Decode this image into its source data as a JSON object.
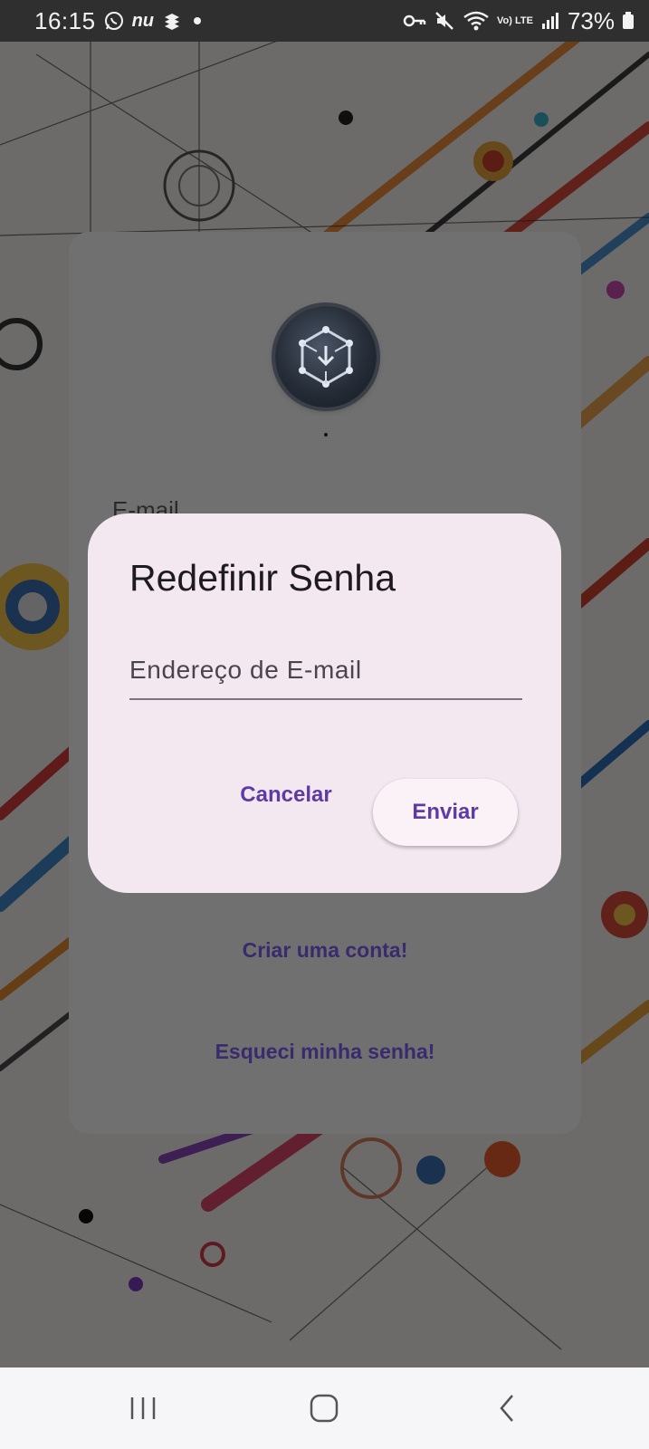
{
  "status_bar": {
    "time": "16:15",
    "left_icons": [
      "whatsapp-icon",
      "nubank-icon",
      "app-icon",
      "notification-dot"
    ],
    "nubank_text": "nu",
    "right_icons": [
      "vpn-key-icon",
      "mute-icon",
      "wifi-icon",
      "volte-icon",
      "signal-icon"
    ],
    "volte_text": "Vo) LTE",
    "battery": "73%"
  },
  "login_card": {
    "email_label": "E-mail",
    "create_account_link": "Criar uma conta!",
    "forgot_password_link": "Esqueci minha senha!"
  },
  "dialog": {
    "title": "Redefinir Senha",
    "email_placeholder": "Endereço de E-mail",
    "email_value": "",
    "cancel_label": "Cancelar",
    "send_label": "Enviar"
  },
  "nav_bar": {
    "buttons": [
      "recent-apps",
      "home",
      "back"
    ]
  },
  "colors": {
    "dialog_bg": "#f3e7f0",
    "accent": "#5e3aa8",
    "scrim": "rgba(0,0,0,0.55)"
  }
}
